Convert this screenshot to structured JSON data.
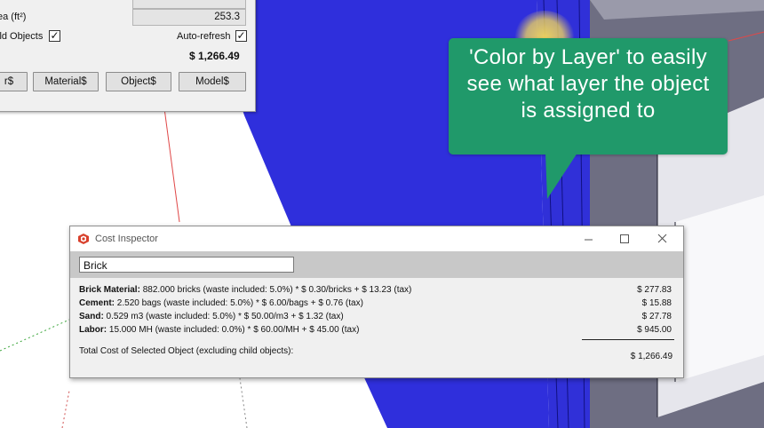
{
  "top_panel": {
    "field_top_value": "",
    "area_label": "ea (ft²)",
    "area_value": "253.3",
    "child_objects_label": "ild Objects",
    "child_objects_checked": "✓",
    "auto_refresh_label": "Auto-refresh",
    "auto_refresh_checked": "✓",
    "total": "$ 1,266.49",
    "buttons": [
      "r$",
      "Material$",
      "Object$",
      "Model$"
    ]
  },
  "callout": {
    "text": "'Color by Layer' to easily see what layer the object is assigned to",
    "color": "#20996a"
  },
  "cost_inspector": {
    "title": "Cost Inspector",
    "icon": "sketchup-logo-icon",
    "controls": {
      "minimize": "minimize-icon",
      "maximize": "maximize-icon",
      "close": "close-icon"
    },
    "search_value": "Brick",
    "rows": [
      {
        "name": "Brick Material:",
        "detail": " 882.000 bricks (waste included: 5.0%) * $ 0.30/bricks + $ 13.23 (tax)",
        "amount": "$ 277.83"
      },
      {
        "name": "Cement:",
        "detail": " 2.520 bags (waste included: 5.0%) * $ 6.00/bags + $ 0.76 (tax)",
        "amount": "$ 15.88"
      },
      {
        "name": "Sand:",
        "detail": " 0.529 m3 (waste included: 5.0%) * $ 50.00/m3 + $ 1.32 (tax)",
        "amount": "$ 27.78"
      },
      {
        "name": "Labor:",
        "detail": " 15.000 MH (waste included: 0.0%) * $ 60.00/MH + $ 45.00 (tax)",
        "amount": "$ 945.00"
      }
    ],
    "total_label": "Total Cost of Selected Object (excluding child objects):",
    "total_value": "$ 1,266.49"
  },
  "colors": {
    "layer_blue": "#2f2fdc",
    "panel_gray": "#f0f0f0",
    "toolbar_gray": "#c8c8c8",
    "side_face_gray": "#6a6a7e"
  }
}
